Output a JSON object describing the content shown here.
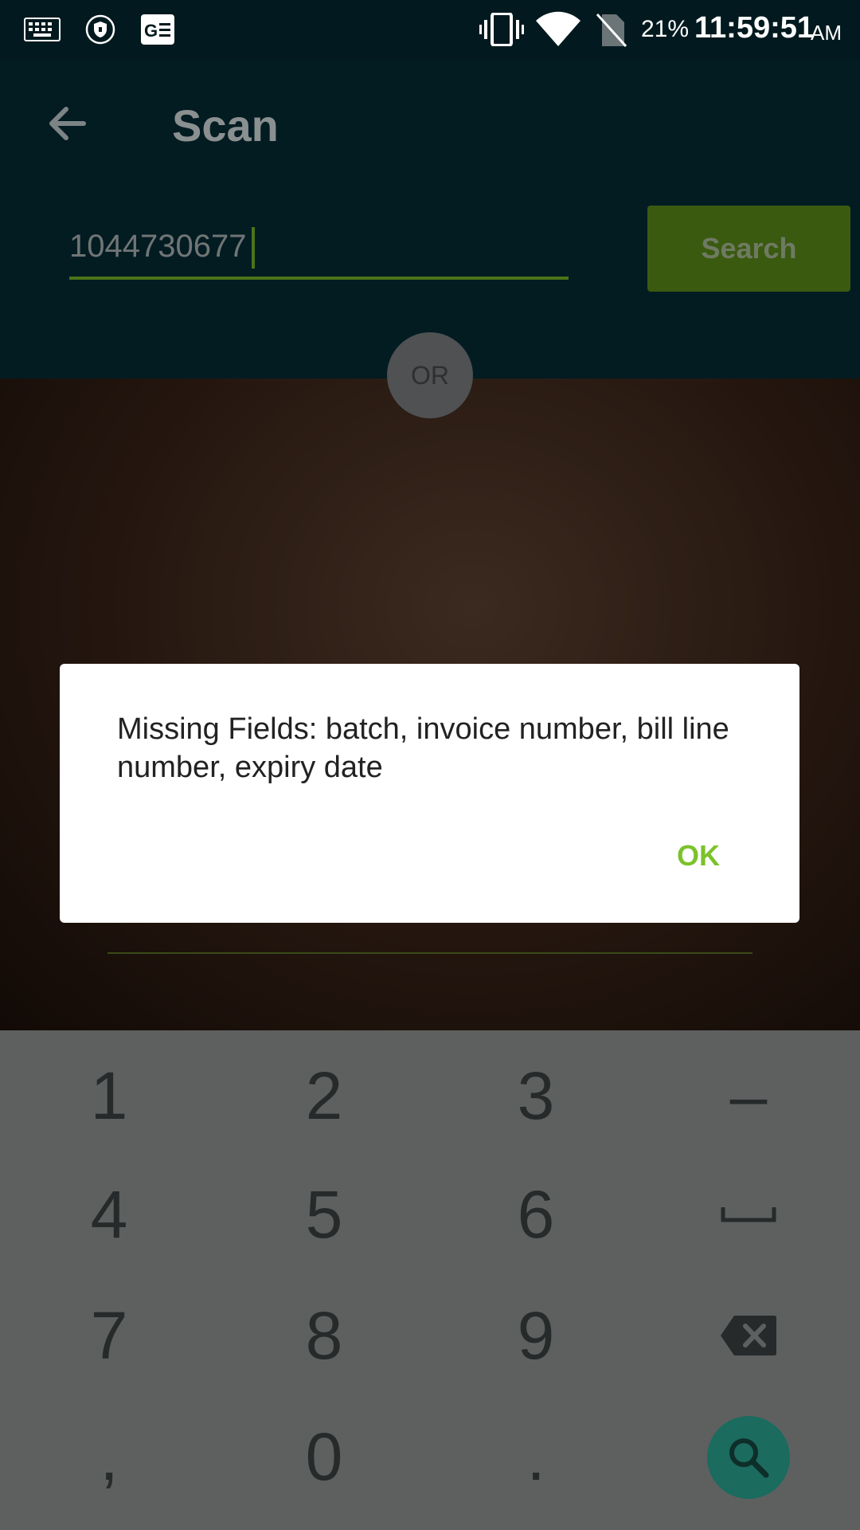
{
  "status_bar": {
    "battery": "21%",
    "time": "11:59:51",
    "ampm": "AM",
    "icons": [
      "keyboard-icon",
      "shield-icon",
      "news-icon",
      "vibrate-icon",
      "wifi-icon",
      "no-sim-icon"
    ]
  },
  "app_bar": {
    "title": "Scan"
  },
  "search": {
    "value": "1044730677",
    "button_label": "Search"
  },
  "or_label": "OR",
  "dialog": {
    "message": "Missing Fields: batch, invoice number, bill line number, expiry date",
    "ok_label": "OK"
  },
  "keyboard": {
    "keys": [
      "1",
      "2",
      "3",
      "–",
      "4",
      "5",
      "6",
      "␣",
      "7",
      "8",
      "9",
      "⌫",
      ",",
      "0",
      ".",
      "search"
    ]
  },
  "colors": {
    "accent": "#7cc22c",
    "search_button": "#3a5a10",
    "app_bar": "#031c22",
    "fab": "#1b6b5f"
  }
}
